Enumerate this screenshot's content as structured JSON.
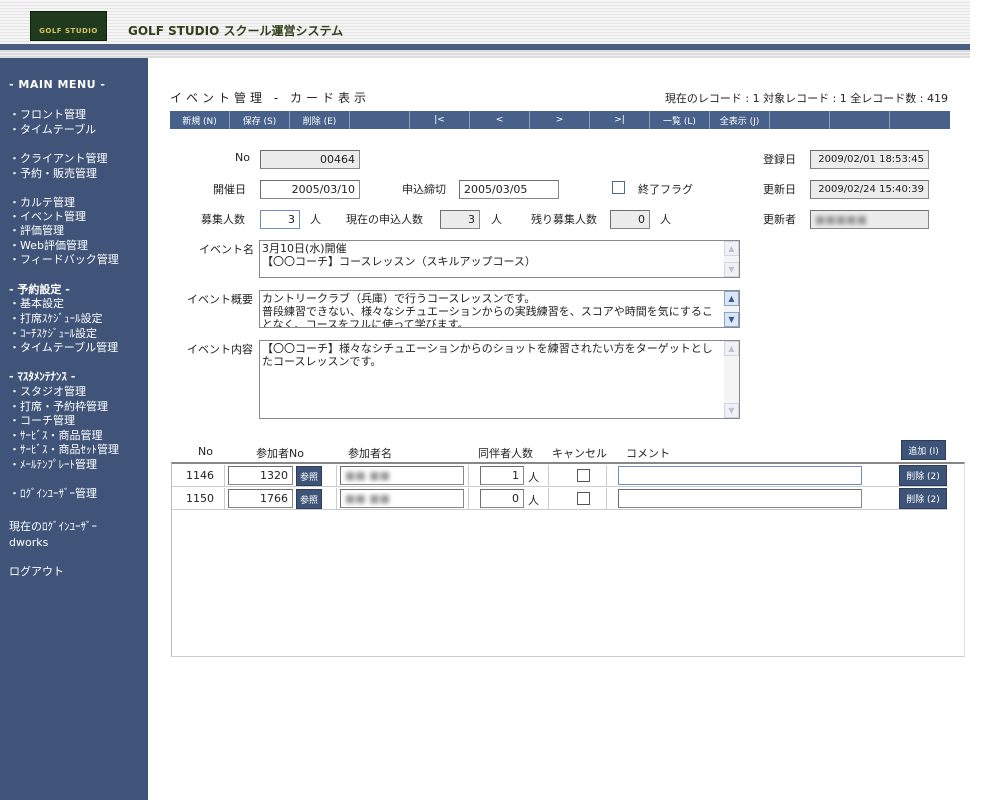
{
  "header": {
    "logo_text": "GOLF STUDIO",
    "app_title": "GOLF STUDIO スクール運営システム",
    "accent": "#48618a"
  },
  "sidebar": {
    "menu_title": "- MAIN MENU -",
    "groups": [
      {
        "items": [
          "・フロント管理",
          "・タイムテーブル"
        ]
      },
      {
        "items": [
          "・クライアント管理",
          "・予約・販売管理"
        ]
      },
      {
        "items": [
          "・カルテ管理",
          "・イベント管理",
          "・評価管理",
          "・Web評価管理",
          "・フィードバック管理"
        ]
      },
      {
        "head": "- 予約設定 -",
        "items": [
          "・基本設定",
          "・打席ｽｹｼﾞｭｰﾙ設定",
          "・ｺｰﾁｽｹｼﾞｭｰﾙ設定",
          "・タイムテーブル管理"
        ]
      },
      {
        "head": "- ﾏｽﾀﾒﾝﾃﾅﾝｽ -",
        "items": [
          "・スタジオ管理",
          "・打席・予約枠管理",
          "・コーチ管理",
          "・ｻｰﾋﾞｽ・商品管理",
          "・ｻｰﾋﾞｽ・商品ｾｯﾄ管理",
          "・ﾒｰﾙﾃﾝﾌﾟﾚｰﾄ管理"
        ]
      },
      {
        "items": [
          "・ﾛｸﾞｲﾝﾕｰｻﾞｰ管理"
        ]
      }
    ],
    "login_label": "現在のﾛｸﾞｲﾝﾕｰｻﾞｰ",
    "login_user": "dworks",
    "logout": "ログアウト"
  },
  "main": {
    "page_title": "イベント管理 - カード表示",
    "record_info": "現在のレコード : 1  対象レコード : 1  全レコード数 : 419",
    "toolbar": [
      {
        "label": "新規 (N)"
      },
      {
        "label": "保存 (S)"
      },
      {
        "label": "削除 (E)"
      },
      {
        "label": ""
      },
      {
        "label": "|<"
      },
      {
        "label": "<"
      },
      {
        "label": ">"
      },
      {
        "label": ">|"
      },
      {
        "label": "一覧 (L)"
      },
      {
        "label": "全表示 (J)"
      },
      {
        "label": ""
      },
      {
        "label": ""
      },
      {
        "label": ""
      }
    ],
    "form": {
      "no_label": "No",
      "no_value": "00464",
      "date_label": "開催日",
      "date_value": "2005/03/10",
      "deadline_label": "申込締切",
      "deadline_value": "2005/03/05",
      "end_flag_label": "終了フラグ",
      "end_flag_checked": false,
      "capacity_label": "募集人数",
      "capacity_value": "3",
      "capacity_unit": "人",
      "current_label": "現在の申込人数",
      "current_value": "3",
      "current_unit": "人",
      "remain_label": "残り募集人数",
      "remain_value": "0",
      "remain_unit": "人",
      "registered_label": "登録日",
      "registered_value": "2009/02/01 18:53:45",
      "updated_label": "更新日",
      "updated_value": "2009/02/24 15:40:39",
      "updater_label": "更新者",
      "updater_value": "■■■■■",
      "event_name_label": "イベント名",
      "event_name_value": "3月10日(水)開催\n【〇〇コーチ】コースレッスン（スキルアップコース）",
      "overview_label": "イベント概要",
      "overview_value": "カントリークラブ（兵庫）で行うコースレッスンです。\n普段練習できない、様々なシチュエーションからの実践練習を、スコアや時間を気にすることなく、コースをフルに使って学びます。",
      "content_label": "イベント内容",
      "content_value": "【〇〇コーチ】様々なシチュエーションからのショットを練習されたい方をターゲットとしたコースレッスンです。"
    },
    "participants": {
      "headers": {
        "no": "No",
        "participant_no": "参加者No",
        "name": "参加者名",
        "companions": "同伴者人数",
        "cancel": "キャンセル",
        "comment": "コメント"
      },
      "add_label": "追加 (I)",
      "ref_label": "参照",
      "delete_label": "削除 (2)",
      "unit": "人",
      "rows": [
        {
          "no": "1146",
          "participant_no": "1320",
          "name": "■■ ■■",
          "companions": "1",
          "cancel": false,
          "comment": ""
        },
        {
          "no": "1150",
          "participant_no": "1766",
          "name": "■■ ■■",
          "companions": "0",
          "cancel": false,
          "comment": ""
        }
      ]
    }
  }
}
